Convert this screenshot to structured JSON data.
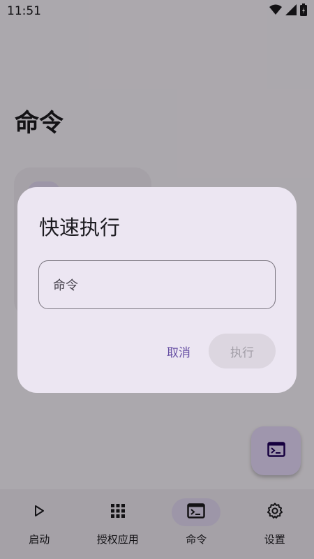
{
  "status_bar": {
    "time": "11:51"
  },
  "page": {
    "title": "命令"
  },
  "dialog": {
    "title": "快速执行",
    "input_placeholder": "命令",
    "cancel_label": "取消",
    "run_label": "执行"
  },
  "bottom_nav": {
    "items": [
      {
        "label": "启动",
        "icon": "play-icon"
      },
      {
        "label": "授权应用",
        "icon": "grid-icon"
      },
      {
        "label": "命令",
        "icon": "terminal-icon",
        "active": true
      },
      {
        "label": "设置",
        "icon": "gear-icon"
      }
    ]
  },
  "colors": {
    "accent": "#6750a4",
    "surface": "#ece6f2",
    "fab": "#eaddff",
    "scrim": "rgba(0,0,0,0.32)"
  }
}
